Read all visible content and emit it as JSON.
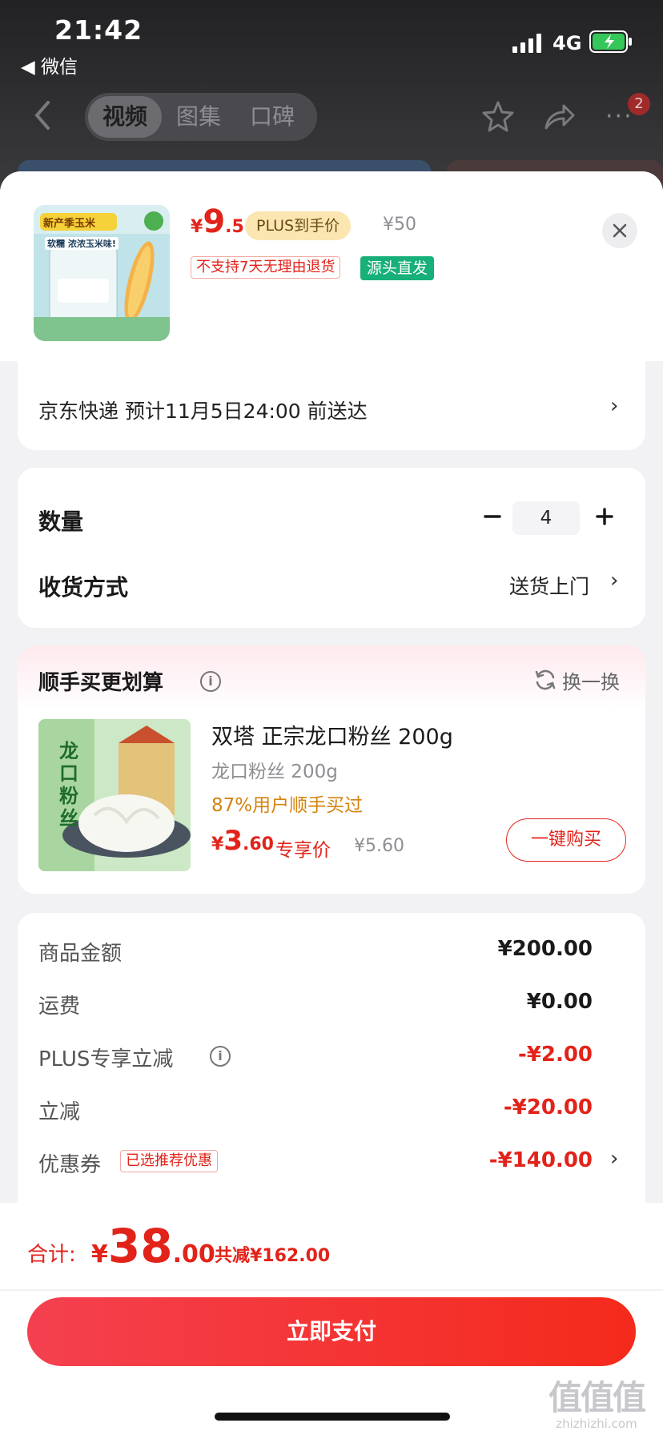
{
  "status_bar": {
    "time": "21:42",
    "back_app": "◀ 微信",
    "network": "4G"
  },
  "nav": {
    "tabs": [
      {
        "label": "视频",
        "active": true
      },
      {
        "label": "图集",
        "active": false
      },
      {
        "label": "口碑",
        "active": false
      }
    ],
    "more_glyph": "···",
    "badge_count": "2"
  },
  "product": {
    "price_currency": "¥",
    "price_int": "9",
    "price_dec": ".5",
    "plus_label": "PLUS到手价",
    "original_price": "¥50",
    "no_return_tag": "不支持7天无理由退货",
    "source_tag": "源头直发",
    "thumb_banner": "新产季玉米",
    "thumb_slogan": "软糯 浓浓玉米味!"
  },
  "delivery": {
    "text": "京东快递  预计11月5日24:00 前送达"
  },
  "quantity": {
    "label": "数量",
    "value": "4",
    "minus_glyph": "−",
    "plus_glyph": "+"
  },
  "shipping": {
    "label": "收货方式",
    "value": "送货上门"
  },
  "addon": {
    "title": "顺手买更划算",
    "swap_label": "换一换",
    "name": "双塔 正宗龙口粉丝 200g",
    "spec": "龙口粉丝 200g",
    "social_proof": "87%用户顺手买过",
    "price_currency": "¥",
    "price_int": "3",
    "price_dec": ".60",
    "price_label": "专享价",
    "original_price": "¥5.60",
    "buy_button": "一键购买",
    "thumb_text": "龙口粉丝"
  },
  "summary": {
    "rows": [
      {
        "label": "商品金额",
        "value": "¥200.00",
        "color": "#1a1a1a"
      },
      {
        "label": "运费",
        "value": "¥0.00",
        "color": "#1a1a1a"
      },
      {
        "label": "PLUS专享立减",
        "value": "-¥2.00",
        "color": "#e2231a"
      },
      {
        "label": "立减",
        "value": "-¥20.00",
        "color": "#e2231a"
      },
      {
        "label": "优惠券",
        "value": "-¥140.00",
        "color": "#e2231a"
      }
    ],
    "coupon_tag": "已选推荐优惠"
  },
  "footer": {
    "total_label": "合计:",
    "total_currency": "¥",
    "total_int": "38",
    "total_dec": ".00",
    "saved": "共减¥162.00",
    "pay_button": "立即支付"
  },
  "watermark": {
    "glyphs": "值值值",
    "url": "zhizhizhi.com"
  },
  "colors": {
    "accent_red": "#e2231a",
    "plus_gold": "#fbe5b0",
    "source_green": "#16b078",
    "social_orange": "#d4840f"
  }
}
